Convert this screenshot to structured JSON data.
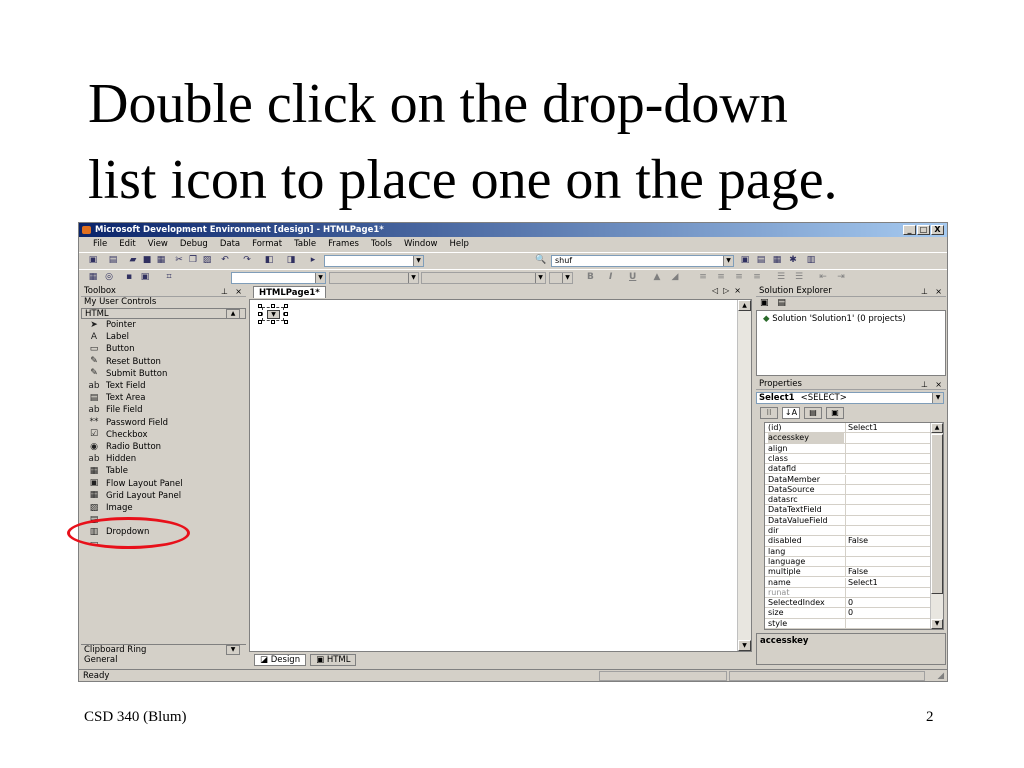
{
  "slide": {
    "title_line1": "Double click on the drop-down",
    "title_line2": "list icon to place one on the page.",
    "footer_left": "CSD 340 (Blum)",
    "page_number": "2"
  },
  "window": {
    "title": "Microsoft Development Environment [design] - HTMLPage1*",
    "minimize": "_",
    "maximize": "□",
    "close": "X"
  },
  "menu": [
    "File",
    "Edit",
    "View",
    "Debug",
    "Data",
    "Format",
    "Table",
    "Frames",
    "Tools",
    "Window",
    "Help"
  ],
  "toolbar": {
    "find_value": "shuf",
    "bold": "B",
    "italic": "I",
    "underline": "U"
  },
  "toolbox": {
    "title": "Toolbox",
    "section_user": "My User Controls",
    "section_html": "HTML",
    "items": [
      {
        "label": "Pointer",
        "icon": "pointer-icon",
        "glyph": "➤"
      },
      {
        "label": "Label",
        "icon": "label-icon",
        "glyph": "A"
      },
      {
        "label": "Button",
        "icon": "button-icon",
        "glyph": "▭"
      },
      {
        "label": "Reset Button",
        "icon": "reset-button-icon",
        "glyph": "✎"
      },
      {
        "label": "Submit Button",
        "icon": "submit-button-icon",
        "glyph": "✎"
      },
      {
        "label": "Text Field",
        "icon": "text-field-icon",
        "glyph": "ab"
      },
      {
        "label": "Text Area",
        "icon": "text-area-icon",
        "glyph": "▤"
      },
      {
        "label": "File Field",
        "icon": "file-field-icon",
        "glyph": "ab"
      },
      {
        "label": "Password Field",
        "icon": "password-field-icon",
        "glyph": "**"
      },
      {
        "label": "Checkbox",
        "icon": "checkbox-icon",
        "glyph": "☑"
      },
      {
        "label": "Radio Button",
        "icon": "radio-button-icon",
        "glyph": "◉"
      },
      {
        "label": "Hidden",
        "icon": "hidden-icon",
        "glyph": "ab"
      },
      {
        "label": "Table",
        "icon": "table-icon",
        "glyph": "▦"
      },
      {
        "label": "Flow Layout Panel",
        "icon": "flow-layout-panel-icon",
        "glyph": "▣"
      },
      {
        "label": "Grid Layout Panel",
        "icon": "grid-layout-panel-icon",
        "glyph": "▦"
      },
      {
        "label": "Image",
        "icon": "image-icon",
        "glyph": "▨"
      },
      {
        "label": "",
        "icon": "listbox-icon",
        "glyph": "▤"
      },
      {
        "label": "Dropdown",
        "icon": "dropdown-icon",
        "glyph": "▥"
      },
      {
        "label": "",
        "icon": "horizontal-rule-icon",
        "glyph": "▭"
      }
    ],
    "section_clipboard": "Clipboard Ring",
    "section_general": "General"
  },
  "editor": {
    "tab": "HTMLPage1*",
    "view_design": "Design",
    "view_html": "HTML"
  },
  "solution_explorer": {
    "title": "Solution Explorer",
    "root": "Solution 'Solution1' (0 projects)"
  },
  "properties": {
    "title": "Properties",
    "object_name": "Select1",
    "object_type": "<SELECT>",
    "rows": [
      {
        "name": "(id)",
        "value": "Select1"
      },
      {
        "name": "accesskey",
        "value": ""
      },
      {
        "name": "align",
        "value": ""
      },
      {
        "name": "class",
        "value": ""
      },
      {
        "name": "datafld",
        "value": ""
      },
      {
        "name": "DataMember",
        "value": ""
      },
      {
        "name": "DataSource",
        "value": ""
      },
      {
        "name": "datasrc",
        "value": ""
      },
      {
        "name": "DataTextField",
        "value": ""
      },
      {
        "name": "DataValueField",
        "value": ""
      },
      {
        "name": "dir",
        "value": ""
      },
      {
        "name": "disabled",
        "value": "False"
      },
      {
        "name": "lang",
        "value": ""
      },
      {
        "name": "language",
        "value": ""
      },
      {
        "name": "multiple",
        "value": "False"
      },
      {
        "name": "name",
        "value": "Select1"
      },
      {
        "name": "runat",
        "value": ""
      },
      {
        "name": "SelectedIndex",
        "value": "0"
      },
      {
        "name": "size",
        "value": "0"
      },
      {
        "name": "style",
        "value": ""
      }
    ],
    "description": "accesskey"
  },
  "status": {
    "text": "Ready"
  },
  "colors": {
    "titlebar_start": "#0a246a",
    "titlebar_end": "#a6caf0",
    "chrome": "#d4d0c8",
    "highlight_ring": "#e8101a"
  }
}
